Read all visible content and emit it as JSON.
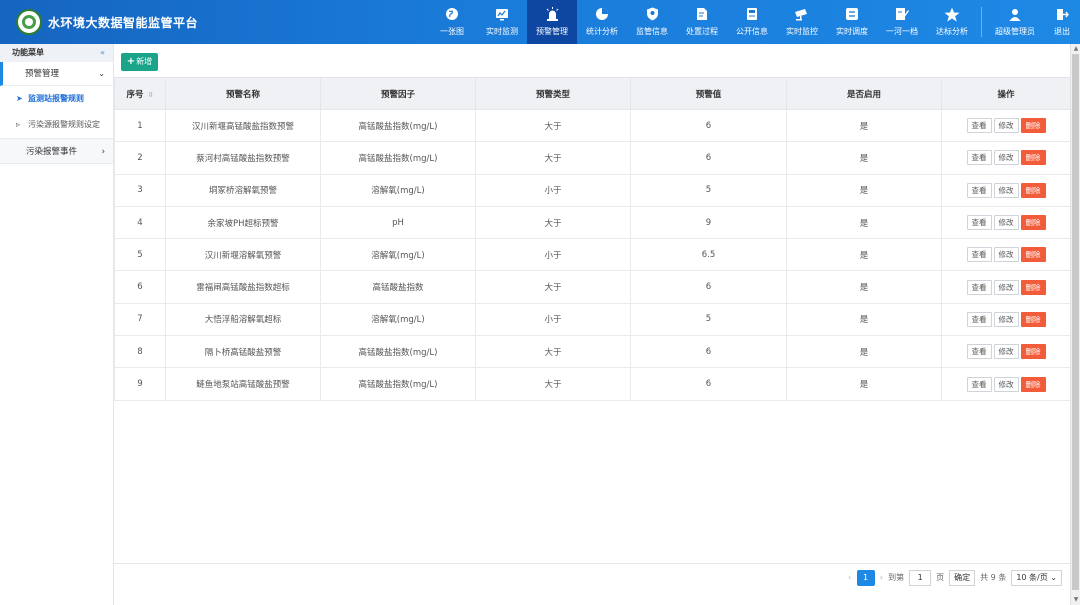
{
  "app": {
    "title": "水环境大数据智能监管平台"
  },
  "nav": [
    {
      "label": "一张图",
      "icon": "globe-icon"
    },
    {
      "label": "实时监测",
      "icon": "monitor-chart-icon"
    },
    {
      "label": "预警管理",
      "icon": "alarm-light-icon",
      "active": true
    },
    {
      "label": "统计分析",
      "icon": "pie-chart-icon"
    },
    {
      "label": "监管信息",
      "icon": "shield-icon"
    },
    {
      "label": "处置过程",
      "icon": "edit-document-icon"
    },
    {
      "label": "公开信息",
      "icon": "document-icon"
    },
    {
      "label": "实时监控",
      "icon": "cctv-camera-icon"
    },
    {
      "label": "实时调度",
      "icon": "dispatch-icon"
    },
    {
      "label": "一河一档",
      "icon": "archive-edit-icon"
    },
    {
      "label": "达标分析",
      "icon": "star-badge-icon"
    },
    {
      "label": "超级管理员",
      "icon": "user-icon"
    },
    {
      "label": "退出",
      "icon": "logout-icon"
    }
  ],
  "sidebar": {
    "header": "功能菜单",
    "collapse_glyph": "«",
    "group": "预警管理",
    "items": [
      {
        "label": "监测站报警规则",
        "active": true
      },
      {
        "label": "污染源报警规则设定",
        "active": false
      }
    ],
    "group2": "污染报警事件"
  },
  "toolbar": {
    "add_label": "新增"
  },
  "table": {
    "headers": [
      "序号",
      "预警名称",
      "预警因子",
      "预警类型",
      "预警值",
      "是否启用",
      "操作"
    ],
    "rows": [
      [
        "1",
        "汉川新堰高锰酸盐指数预警",
        "高锰酸盐指数(mg/L)",
        "大于",
        "6",
        "是"
      ],
      [
        "2",
        "蔡河村高锰酸盐指数预警",
        "高锰酸盐指数(mg/L)",
        "大于",
        "6",
        "是"
      ],
      [
        "3",
        "垌冢桥溶解氧预警",
        "溶解氧(mg/L)",
        "小于",
        "5",
        "是"
      ],
      [
        "4",
        "余家坡PH超标预警",
        "pH",
        "大于",
        "9",
        "是"
      ],
      [
        "5",
        "汉川新堰溶解氧预警",
        "溶解氧(mg/L)",
        "小于",
        "6.5",
        "是"
      ],
      [
        "6",
        "雷福闸高锰酸盐指数超标",
        "高锰酸盐指数",
        "大于",
        "6",
        "是"
      ],
      [
        "7",
        "大悟浮船溶解氧超标",
        "溶解氧(mg/L)",
        "小于",
        "5",
        "是"
      ],
      [
        "8",
        "隔卜桥高锰酸盐预警",
        "高锰酸盐指数(mg/L)",
        "大于",
        "6",
        "是"
      ],
      [
        "9",
        "鲢鱼地泵站高锰酸盐预警",
        "高锰酸盐指数(mg/L)",
        "大于",
        "6",
        "是"
      ]
    ],
    "actions": {
      "view": "查看",
      "edit": "修改",
      "delete": "删除"
    }
  },
  "pagination": {
    "current_page": "1",
    "goto_label": "到第",
    "goto_value": "1",
    "page_unit": "页",
    "confirm": "确定",
    "total": "共 9 条",
    "page_size": "10 条/页"
  },
  "colors": {
    "header": "#1a7ad8",
    "active_nav": "#0d47a1",
    "add_button": "#1aa58a",
    "delete_button": "#f25c3a",
    "accent": "#1e88e5"
  }
}
